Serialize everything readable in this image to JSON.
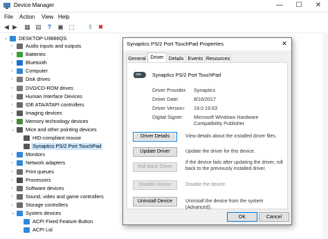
{
  "window": {
    "title": "Device Manager",
    "minimize": "—",
    "maximize": "☐",
    "close": "✕"
  },
  "menu": [
    "File",
    "Action",
    "View",
    "Help"
  ],
  "toolbar": [
    "◀",
    "▶",
    "▦",
    "▤",
    "?",
    "▣",
    "⬚",
    "⇪",
    "✖"
  ],
  "tree": {
    "root": "DESKTOP-U9886QS",
    "items": [
      {
        "label": "Audio inputs and outputs",
        "exp": "›",
        "color": "#6b6b6b",
        "level": 1
      },
      {
        "label": "Batteries",
        "exp": "›",
        "color": "#3aa13a",
        "level": 1
      },
      {
        "label": "Bluetooth",
        "exp": "›",
        "color": "#1f6fd0",
        "level": 1
      },
      {
        "label": "Computer",
        "exp": "›",
        "color": "#2f88d8",
        "level": 1
      },
      {
        "label": "Disk drives",
        "exp": "›",
        "color": "#7a7a7a",
        "level": 1
      },
      {
        "label": "DVD/CD-ROM drives",
        "exp": "›",
        "color": "#7a7a7a",
        "level": 1
      },
      {
        "label": "Human Interface Devices",
        "exp": "›",
        "color": "#6a6a6a",
        "level": 1
      },
      {
        "label": "IDE ATA/ATAPI controllers",
        "exp": "›",
        "color": "#6a6a6a",
        "level": 1
      },
      {
        "label": "Imaging devices",
        "exp": "›",
        "color": "#5a5a5a",
        "level": 1
      },
      {
        "label": "Memory technology devices",
        "exp": "›",
        "color": "#4a8a3a",
        "level": 1
      },
      {
        "label": "Mice and other pointing devices",
        "exp": "⌄",
        "color": "#555",
        "level": 1
      },
      {
        "label": "HID-compliant mouse",
        "exp": "",
        "color": "#555",
        "level": 2
      },
      {
        "label": "Synaptics PS/2 Port TouchPad",
        "exp": "",
        "color": "#555",
        "level": 2
      },
      {
        "label": "Monitors",
        "exp": "›",
        "color": "#2f88d8",
        "level": 1
      },
      {
        "label": "Network adapters",
        "exp": "›",
        "color": "#2f88d8",
        "level": 1
      },
      {
        "label": "Print queues",
        "exp": "›",
        "color": "#6a6a6a",
        "level": 1
      },
      {
        "label": "Processors",
        "exp": "›",
        "color": "#4a4a4a",
        "level": 1
      },
      {
        "label": "Software devices",
        "exp": "›",
        "color": "#6a6a6a",
        "level": 1
      },
      {
        "label": "Sound, video and game controllers",
        "exp": "›",
        "color": "#6a6a6a",
        "level": 1
      },
      {
        "label": "Storage controllers",
        "exp": "›",
        "color": "#6a6a6a",
        "level": 1
      },
      {
        "label": "System devices",
        "exp": "⌄",
        "color": "#2f88d8",
        "level": 1
      },
      {
        "label": "ACPI Fixed Feature Button",
        "exp": "",
        "color": "#2f88d8",
        "level": 2
      },
      {
        "label": "ACPI Lid",
        "exp": "",
        "color": "#2f88d8",
        "level": 2
      }
    ]
  },
  "dialog": {
    "title": "Synaptics PS/2 Port TouchPad Properties",
    "close": "✕",
    "tabs": [
      "General",
      "Driver",
      "Details",
      "Events",
      "Resources"
    ],
    "device_name": "Synaptics PS/2 Port TouchPad",
    "fields": [
      {
        "label": "Driver Provider:",
        "value": "Synaptics"
      },
      {
        "label": "Driver Date:",
        "value": "8/16/2017"
      },
      {
        "label": "Driver Version:",
        "value": "19.0.19.63"
      },
      {
        "label": "Digital Signer:",
        "value": "Microsoft Windows Hardware Compatibility Publisher"
      }
    ],
    "actions": [
      {
        "button": "Driver Details",
        "desc": "View details about the installed driver files.",
        "enabled": true
      },
      {
        "button": "Update Driver",
        "desc": "Update the driver for this device.",
        "enabled": true
      },
      {
        "button": "Roll Back Driver",
        "desc": "If the device fails after updating the driver, roll back to the previously installed driver.",
        "enabled": false
      },
      {
        "button": "Disable Device",
        "desc": "Disable the device.",
        "enabled": false
      },
      {
        "button": "Uninstall Device",
        "desc": "Uninstall the device from the system (Advanced).",
        "enabled": true
      }
    ],
    "ok": "OK",
    "cancel": "Cancel"
  }
}
